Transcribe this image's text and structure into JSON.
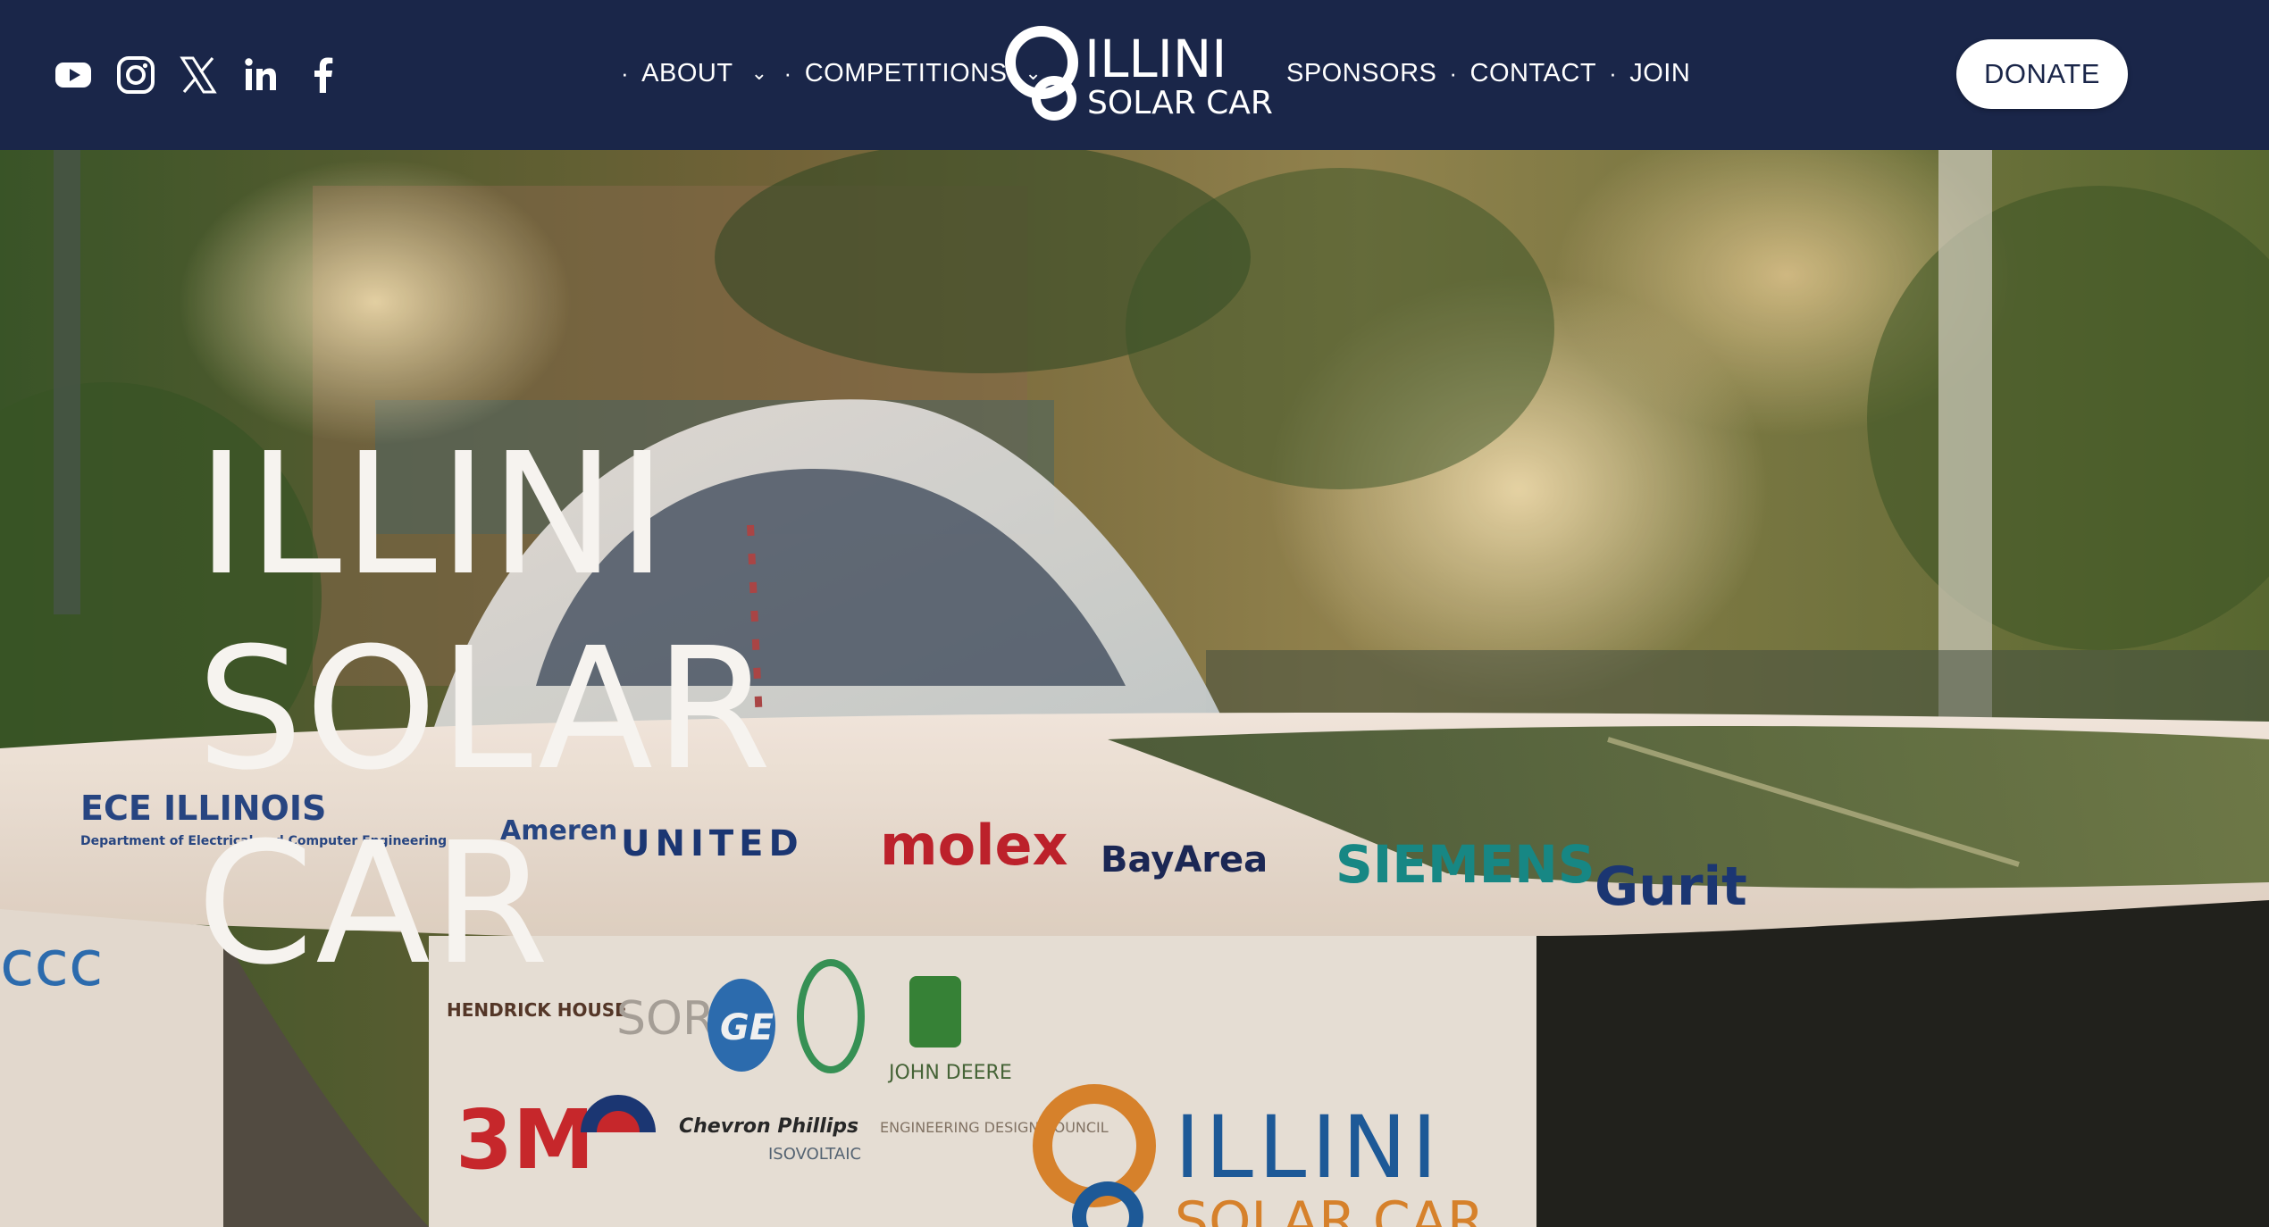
{
  "social": {
    "items": [
      {
        "name": "youtube-icon"
      },
      {
        "name": "instagram-icon"
      },
      {
        "name": "x-icon"
      },
      {
        "name": "linkedin-icon"
      },
      {
        "name": "facebook-icon"
      }
    ]
  },
  "nav": {
    "about": "ABOUT",
    "competitions": "COMPETITIONS",
    "sponsors": "SPONSORS",
    "contact": "CONTACT",
    "join": "JOIN",
    "separator": "·",
    "chevron": "⌄"
  },
  "logo": {
    "line1": "ILLINI",
    "line2": "SOLAR CAR"
  },
  "donate": {
    "label": "DONATE"
  },
  "hero": {
    "title_lines": [
      "ILLINI",
      "SOLAR",
      "CAR"
    ]
  },
  "car_decals": {
    "ece": "ECE ILLINOIS",
    "ece_sub": "Department of Electrical and Computer Engineering",
    "ameren": "Ameren",
    "united": "UNITED",
    "molex": "molex",
    "bayarea": "BayArea",
    "siemens": "SIEMENS",
    "gurit": "Gurit",
    "hendrick": "HENDRICK HOUSE",
    "sorf": "SORF",
    "ge": "GE",
    "johndeere": "JOHN DEERE",
    "threem": "3M",
    "chevron": "Chevron Phillips",
    "isovoltaic": "ISOVOLTAIC",
    "edc": "ENGINEERING DESIGN COUNCIL",
    "car_logo_line1": "ILLINI",
    "car_logo_line2": "SOLAR CAR",
    "ccc": "ccc"
  },
  "colors": {
    "navy": "#1a2649",
    "white": "#ffffff",
    "molex_red": "#c8242e",
    "siemens_teal": "#19908d",
    "car_blue": "#1f5fa1",
    "car_orange": "#e48a2e"
  }
}
